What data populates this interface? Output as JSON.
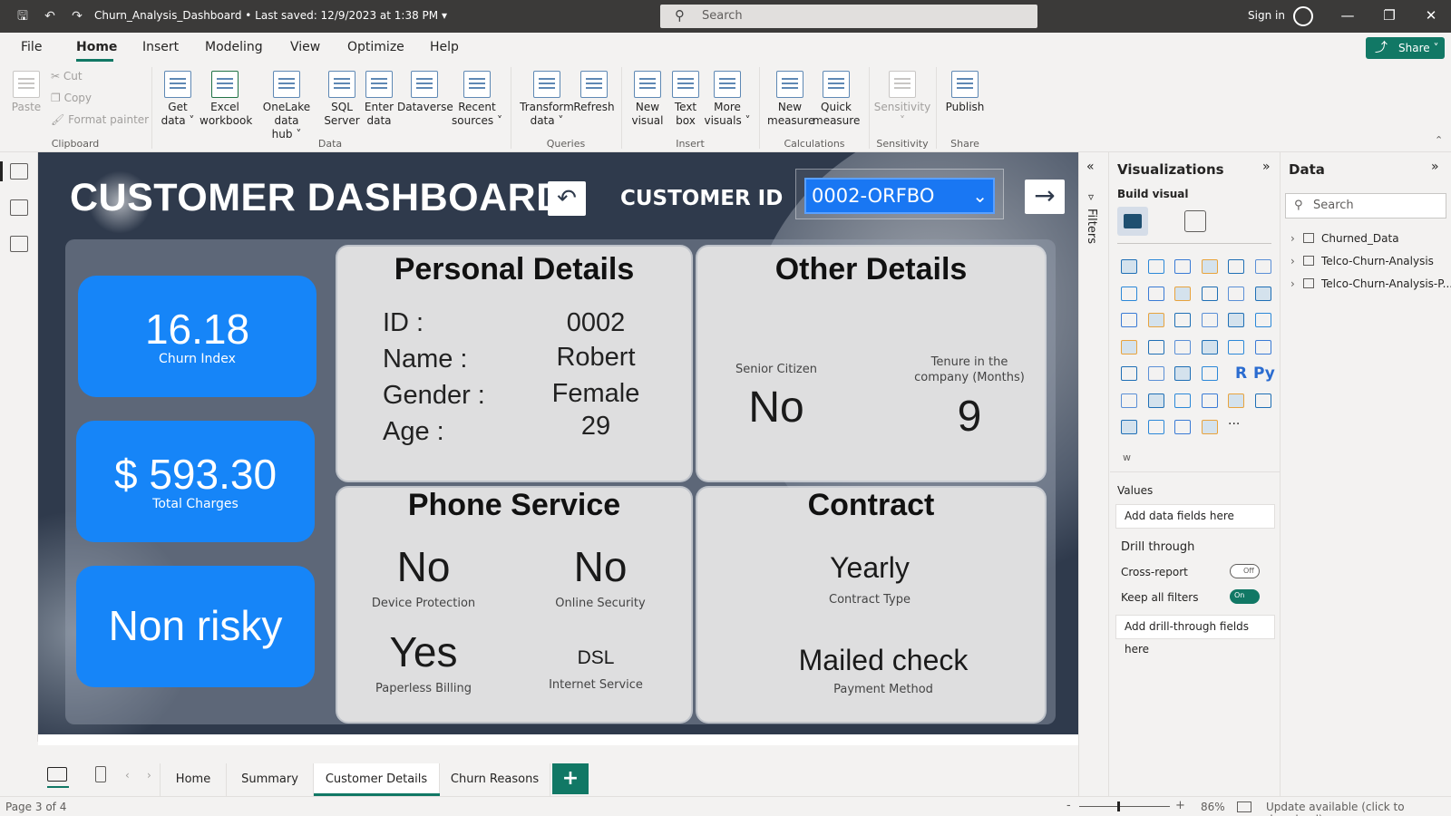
{
  "titlebar": {
    "title": "Churn_Analysis_Dashboard • Last saved: 12/9/2023 at 1:38 PM",
    "search_placeholder": "Search",
    "signin": "Sign in"
  },
  "menu": {
    "items": [
      "File",
      "Home",
      "Insert",
      "Modeling",
      "View",
      "Optimize",
      "Help"
    ],
    "share": "Share"
  },
  "ribbon": {
    "clipboard": {
      "paste": "Paste",
      "cut": "Cut",
      "copy": "Copy",
      "format_painter": "Format painter",
      "label": "Clipboard"
    },
    "data": {
      "buttons": [
        {
          "l1": "Get",
          "l2": "data ˅"
        },
        {
          "l1": "Excel",
          "l2": "workbook"
        },
        {
          "l1": "OneLake data",
          "l2": "hub ˅"
        },
        {
          "l1": "SQL",
          "l2": "Server"
        },
        {
          "l1": "Enter",
          "l2": "data"
        },
        {
          "l1": "Dataverse",
          "l2": ""
        },
        {
          "l1": "Recent",
          "l2": "sources ˅"
        }
      ],
      "label": "Data"
    },
    "queries": {
      "buttons": [
        {
          "l1": "Transform",
          "l2": "data ˅"
        },
        {
          "l1": "Refresh",
          "l2": ""
        }
      ],
      "label": "Queries"
    },
    "insert": {
      "buttons": [
        {
          "l1": "New",
          "l2": "visual"
        },
        {
          "l1": "Text",
          "l2": "box"
        },
        {
          "l1": "More",
          "l2": "visuals ˅"
        }
      ],
      "label": "Insert"
    },
    "calculations": {
      "buttons": [
        {
          "l1": "New",
          "l2": "measure"
        },
        {
          "l1": "Quick",
          "l2": "measure"
        }
      ],
      "label": "Calculations"
    },
    "sensitivity": {
      "buttons": [
        {
          "l1": "Sensitivity",
          "l2": "˅"
        }
      ],
      "label": "Sensitivity"
    },
    "share": {
      "buttons": [
        {
          "l1": "Publish",
          "l2": ""
        }
      ],
      "label": "Share"
    }
  },
  "dashboard": {
    "title": "CUSTOMER DASHBOARD",
    "customer_id_label": "CUSTOMER ID",
    "customer_id_value": "0002-ORFBO",
    "kpis": [
      {
        "value": "16.18",
        "label": "Churn Index"
      },
      {
        "value": "$ 593.30",
        "label": "Total Charges"
      },
      {
        "value": "Non risky",
        "label": ""
      }
    ],
    "personal": {
      "title": "Personal Details",
      "rows": [
        {
          "label": "ID :",
          "value": "0002"
        },
        {
          "label": "Name :",
          "value": "Robert"
        },
        {
          "label": "Gender :",
          "value": "Female"
        },
        {
          "label": "Age :",
          "value": "29"
        }
      ]
    },
    "other": {
      "title": "Other Details",
      "senior_label": "Senior Citizen",
      "senior_value": "No",
      "tenure_label_1": "Tenure in the",
      "tenure_label_2": "company (Months)",
      "tenure_value": "9"
    },
    "phone": {
      "title": "Phone Service",
      "items": [
        {
          "value": "No",
          "label": "Device Protection"
        },
        {
          "value": "No",
          "label": "Online Security"
        },
        {
          "value": "Yes",
          "label": "Paperless Billing"
        },
        {
          "value": "DSL",
          "label": "Internet Service"
        }
      ]
    },
    "contract": {
      "title": "Contract",
      "type_value": "Yearly",
      "type_label": "Contract Type",
      "payment_value": "Mailed check",
      "payment_label": "Payment Method"
    }
  },
  "pages": {
    "tabs": [
      "Home",
      "Summary",
      "Customer Details",
      "Churn Reasons"
    ],
    "active": "Customer Details",
    "add": "+"
  },
  "status": {
    "page": "Page 3 of 4",
    "zoom": "86%",
    "update": "Update available (click to download)"
  },
  "filters": {
    "label": "Filters"
  },
  "visualizations": {
    "title": "Visualizations",
    "build_visual": "Build visual",
    "values_label": "Values",
    "values_placeholder": "Add data fields here",
    "drill_label": "Drill through",
    "cross_report": "Cross-report",
    "cross_report_state": "Off",
    "keep_filters": "Keep all filters",
    "keep_filters_state": "On",
    "drill_placeholder": "Add drill-through fields here",
    "icon_R": "R",
    "icon_Py": "Py",
    "icon_more": "···",
    "icon_w": "w"
  },
  "data_pane": {
    "title": "Data",
    "search_placeholder": "Search",
    "tables": [
      "Churned_Data",
      "Telco-Churn-Analysis",
      "Telco-Churn-Analysis-P..."
    ]
  },
  "colors": {
    "accent": "#117865",
    "kpi_blue": "#1685f8",
    "canvas_bg": "#2f3a4c",
    "card_bg": "#dededf"
  }
}
